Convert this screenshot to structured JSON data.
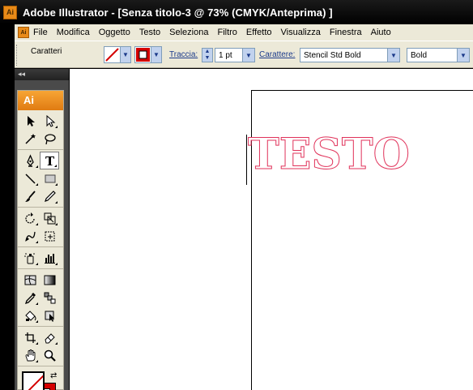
{
  "window": {
    "app_icon_label": "Ai",
    "title": "Adobe Illustrator - [Senza titolo-3 @ 73% (CMYK/Anteprima) ]"
  },
  "menubar": {
    "doc_icon_label": "Ai",
    "items": [
      "File",
      "Modifica",
      "Oggetto",
      "Testo",
      "Seleziona",
      "Filtro",
      "Effetto",
      "Visualizza",
      "Finestra",
      "Aiuto"
    ]
  },
  "controlbar": {
    "panel_label": "Caratteri",
    "stroke_link": "Traccia:",
    "stroke_weight": "1 pt",
    "character_link": "Carattere:",
    "font_family": "Stencil Std Bold",
    "font_style": "Bold"
  },
  "tools_panel": {
    "collapse_label": "◂◂",
    "brand": "Ai"
  },
  "canvas": {
    "text_content": "TESTO"
  },
  "colors": {
    "accent": "#e88a18",
    "stroke_color": "#d40000",
    "text_stroke": "#e0325a",
    "chrome": "#ece9d8"
  }
}
